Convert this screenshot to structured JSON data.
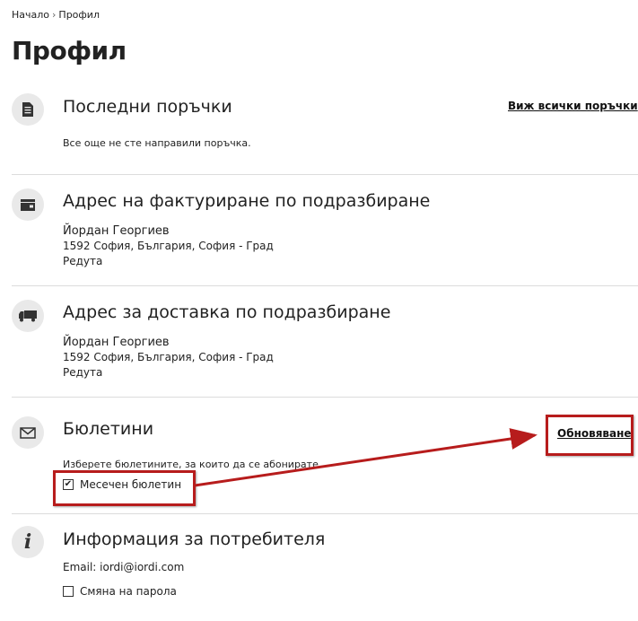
{
  "breadcrumb": {
    "home": "Начало",
    "separator": "›",
    "current": "Профил"
  },
  "page_title": "Профил",
  "orders": {
    "title": "Последни поръчки",
    "view_all": "Виж всички поръчки",
    "empty_text": "Все още не сте направили поръчка."
  },
  "billing": {
    "title": "Адрес на фактуриране по подразбиране",
    "name": "Йордан Георгиев",
    "line1": "1592 София, България, София - Град",
    "line2": "Редута"
  },
  "shipping": {
    "title": "Адрес за доставка по подразбиране",
    "name": "Йордан Георгиев",
    "line1": "1592 София, България, София - Град",
    "line2": "Редута"
  },
  "newsletters": {
    "title": "Бюлетини",
    "update": "Обновяване",
    "description": "Изберете бюлетините, за които да се абонирате.",
    "monthly_label": "Месечен бюлетин",
    "monthly_checked": true
  },
  "user_info": {
    "title": "Информация за потребителя",
    "email_text": "Email: iordi@iordi.com",
    "change_password": "Смяна на парола",
    "change_password_checked": false
  },
  "colors": {
    "annotation_red": "#b71c1c",
    "icon_bg": "#e9e9e9",
    "divider": "#dcdcdc"
  },
  "icons": [
    "document-icon",
    "wallet-icon",
    "truck-icon",
    "envelope-icon",
    "info-icon"
  ]
}
